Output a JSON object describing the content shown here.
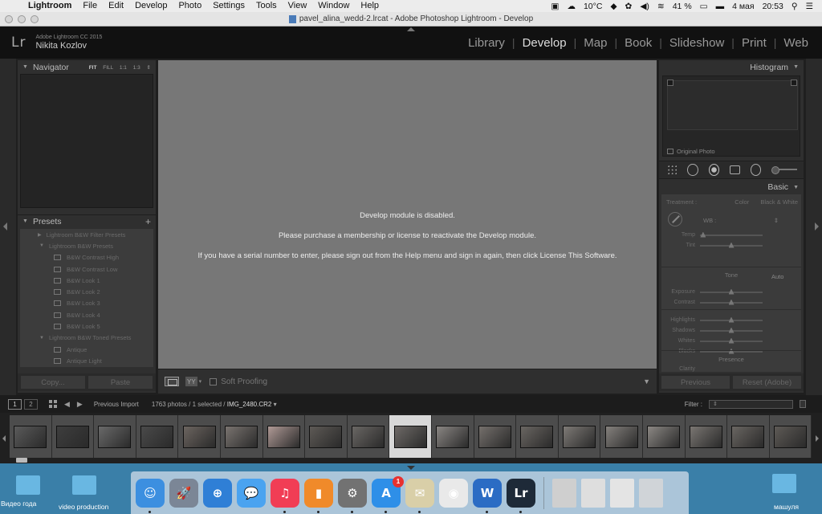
{
  "menubar": {
    "app": "Lightroom",
    "items": [
      "File",
      "Edit",
      "Develop",
      "Photo",
      "Settings",
      "Tools",
      "View",
      "Window",
      "Help"
    ],
    "status": {
      "temperature": "10°C",
      "battery": "41 %",
      "date": "4 мая",
      "time": "20:53"
    }
  },
  "window": {
    "title": "pavel_alina_wedd-2.lrcat - Adobe Photoshop Lightroom - Develop"
  },
  "identity": {
    "logo": "Lr",
    "product": "Adobe Lightroom CC 2015",
    "user": "Nikita Kozlov",
    "modules": [
      "Library",
      "Develop",
      "Map",
      "Book",
      "Slideshow",
      "Print",
      "Web"
    ],
    "active_module": "Develop"
  },
  "navigator": {
    "title": "Navigator",
    "zoom_options": [
      "FIT",
      "FILL",
      "1:1",
      "1:3"
    ],
    "selected_zoom": "FIT"
  },
  "presets": {
    "title": "Presets",
    "rows": [
      {
        "label": "Lightroom B&W Filter Presets",
        "type": "folder",
        "open": false
      },
      {
        "label": "Lightroom B&W Presets",
        "type": "folder",
        "open": true
      },
      {
        "label": "B&W Contrast High",
        "type": "item"
      },
      {
        "label": "B&W Contrast Low",
        "type": "item"
      },
      {
        "label": "B&W Look 1",
        "type": "item"
      },
      {
        "label": "B&W Look 2",
        "type": "item"
      },
      {
        "label": "B&W Look 3",
        "type": "item"
      },
      {
        "label": "B&W Look 4",
        "type": "item"
      },
      {
        "label": "B&W Look 5",
        "type": "item"
      },
      {
        "label": "Lightroom B&W Toned Presets",
        "type": "folder",
        "open": true
      },
      {
        "label": "Antique",
        "type": "item"
      },
      {
        "label": "Antique Light",
        "type": "item"
      }
    ],
    "copy_label": "Copy...",
    "paste_label": "Paste"
  },
  "center": {
    "messages": [
      "Develop module is disabled.",
      "Please purchase a membership or license to reactivate the Develop module.",
      "If you have a serial number to enter, please sign out from the Help menu and sign in again, then click License This Software."
    ],
    "toolbar": {
      "yy_label": "YY",
      "soft_proofing": "Soft Proofing"
    }
  },
  "histogram": {
    "title": "Histogram",
    "original_photo": "Original Photo"
  },
  "basic": {
    "title": "Basic",
    "treatment_label": "Treatment :",
    "treatment_options": [
      "Color",
      "Black & White"
    ],
    "wb_label": "WB :",
    "sliders_wb": [
      {
        "label": "Temp",
        "value": 0.05
      },
      {
        "label": "Tint",
        "value": 0.5
      }
    ],
    "tone_label": "Tone",
    "auto_label": "Auto",
    "sliders_tone1": [
      {
        "label": "Exposure",
        "value": 0.5
      },
      {
        "label": "Contrast",
        "value": 0.5
      }
    ],
    "sliders_tone2": [
      {
        "label": "Highlights",
        "value": 0.5
      },
      {
        "label": "Shadows",
        "value": 0.5
      },
      {
        "label": "Whites",
        "value": 0.5
      },
      {
        "label": "Blacks",
        "value": 0.5
      }
    ],
    "presence_label": "Presence",
    "clarity_label": "Clarity",
    "previous_label": "Previous",
    "reset_label": "Reset (Adobe)"
  },
  "filmbar": {
    "page_buttons": [
      "1",
      "2"
    ],
    "source": "Previous Import",
    "count_text": "1763 photos / 1 selected /",
    "filename": "IMG_2480.CR2",
    "filter_label": "Filter :"
  },
  "filmstrip": {
    "selected_index": 9,
    "thumbs": [
      "#5a5a5a",
      "#3e3e3e",
      "#6a6a6a",
      "#4a4a4a",
      "#6c6560",
      "#7a7470",
      "#b09a96",
      "#5e5a56",
      "#6a6764",
      "#6e6a67",
      "#8a8683",
      "#75706c",
      "#6a6662",
      "#7e7a76",
      "#85817d",
      "#8c8884",
      "#7a7672",
      "#6a6662",
      "#5e5a56"
    ]
  },
  "desktop": {
    "left_items": [
      "Видео года",
      "video production"
    ],
    "right_item": "машуля"
  },
  "dock": {
    "apps": [
      {
        "name": "finder-icon",
        "color": "#3c8fe0",
        "glyph": "☺"
      },
      {
        "name": "launchpad-icon",
        "color": "#7b8696",
        "glyph": "🚀"
      },
      {
        "name": "safari-icon",
        "color": "#2f7fd6",
        "glyph": "⊕"
      },
      {
        "name": "messages-icon",
        "color": "#4aa3f0",
        "glyph": "💬"
      },
      {
        "name": "music-icon",
        "color": "#f13d55",
        "glyph": "♫"
      },
      {
        "name": "books-icon",
        "color": "#f08a2a",
        "glyph": "▮"
      },
      {
        "name": "system-preferences-icon",
        "color": "#727272",
        "glyph": "⚙"
      },
      {
        "name": "app-store-icon",
        "color": "#2e8fe8",
        "glyph": "A",
        "badge": "1"
      },
      {
        "name": "preview-icon",
        "color": "#d9cfa8",
        "glyph": "✉"
      },
      {
        "name": "chrome-icon",
        "color": "#e9e9e9",
        "glyph": "◉"
      },
      {
        "name": "word-icon",
        "color": "#2b6cc4",
        "glyph": "W"
      },
      {
        "name": "lightroom-icon",
        "color": "#1e2a38",
        "glyph": "Lr"
      }
    ],
    "docs": [
      {
        "name": "document-icon",
        "color": "#cfcfcf"
      },
      {
        "name": "word-document-icon",
        "color": "#dedede"
      },
      {
        "name": "screenshot-icon",
        "color": "#e4e4e4"
      },
      {
        "name": "trash-icon",
        "color": "#d0d4d8"
      }
    ]
  }
}
